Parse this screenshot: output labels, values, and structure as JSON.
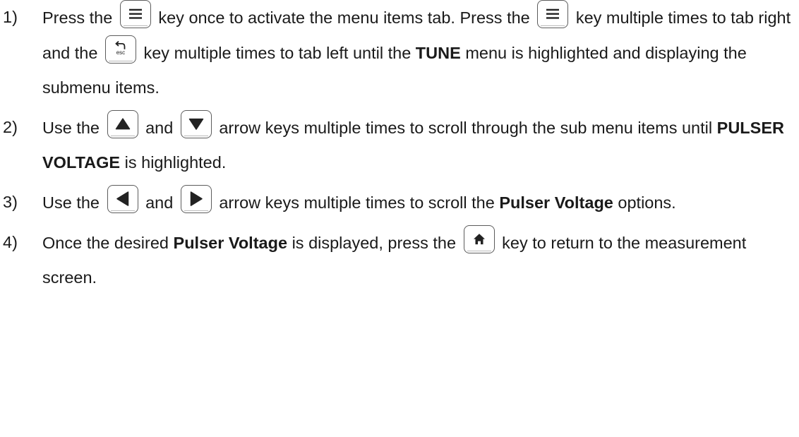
{
  "steps": [
    {
      "num": "1)",
      "t1": "Press the",
      "t2": "key once to activate the menu items tab.  Press the",
      "t3": "key multiple times to tab right and the",
      "t4": "key multiple times to tab left until the",
      "b1": "TUNE",
      "t5": "menu is highlighted and displaying the submenu items."
    },
    {
      "num": "2)",
      "t1": "Use the",
      "t2": "and",
      "t3": "arrow keys multiple times to scroll through the sub menu items until",
      "b1": "PULSER VOLTAGE",
      "t4": "is highlighted."
    },
    {
      "num": "3)",
      "t1": "Use the",
      "t2": "and",
      "t3": "arrow keys multiple times to scroll the",
      "b1": "Pulser Voltage",
      "t4": "options."
    },
    {
      "num": "4)",
      "t1": "Once the desired",
      "b1": "Pulser Voltage",
      "t2": "is displayed, press the",
      "t3": "key to return to the measurement screen."
    }
  ],
  "keys": {
    "menu": "menu-icon",
    "esc": "esc",
    "up": "up-arrow-icon",
    "down": "down-arrow-icon",
    "left": "left-arrow-icon",
    "right": "right-arrow-icon",
    "home": "home-icon"
  },
  "colors": {
    "text": "#1a1a1a",
    "key_border": "#5c5c5c",
    "key_glyph": "#222222"
  }
}
